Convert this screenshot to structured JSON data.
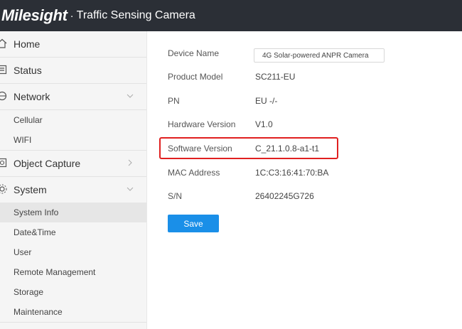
{
  "header": {
    "brand": "Milesight",
    "separator": "·",
    "app_title": "Traffic Sensing Camera"
  },
  "sidebar": {
    "items": [
      {
        "label": "Home",
        "icon": "home-icon"
      },
      {
        "label": "Status",
        "icon": "status-icon"
      },
      {
        "label": "Network",
        "icon": "network-icon",
        "expanded": true,
        "children": [
          "Cellular",
          "WIFI"
        ]
      },
      {
        "label": "Object Capture",
        "icon": "object-capture-icon",
        "expanded": false
      },
      {
        "label": "System",
        "icon": "system-icon",
        "expanded": true,
        "children": [
          "System Info",
          "Date&Time",
          "User",
          "Remote Management",
          "Storage",
          "Maintenance"
        ]
      }
    ],
    "active": "System Info"
  },
  "main": {
    "fields": [
      {
        "key": "Device Name",
        "value": "4G Solar-powered ANPR Camera",
        "type": "input"
      },
      {
        "key": "Product Model",
        "value": "SC211-EU"
      },
      {
        "key": "PN",
        "value": "EU -/-"
      },
      {
        "key": "Hardware Version",
        "value": "V1.0"
      },
      {
        "key": "Software Version",
        "value": "C_21.1.0.8-a1-t1",
        "highlighted": true
      },
      {
        "key": "MAC Address",
        "value": "1C:C3:16:41:70:BA"
      },
      {
        "key": "S/N",
        "value": "26402245G726"
      }
    ],
    "save_label": "Save"
  },
  "colors": {
    "topbar": "#2b2f36",
    "accent": "#1a8fe8",
    "highlight": "#e02020",
    "sidebar_bg": "#f5f5f5"
  }
}
